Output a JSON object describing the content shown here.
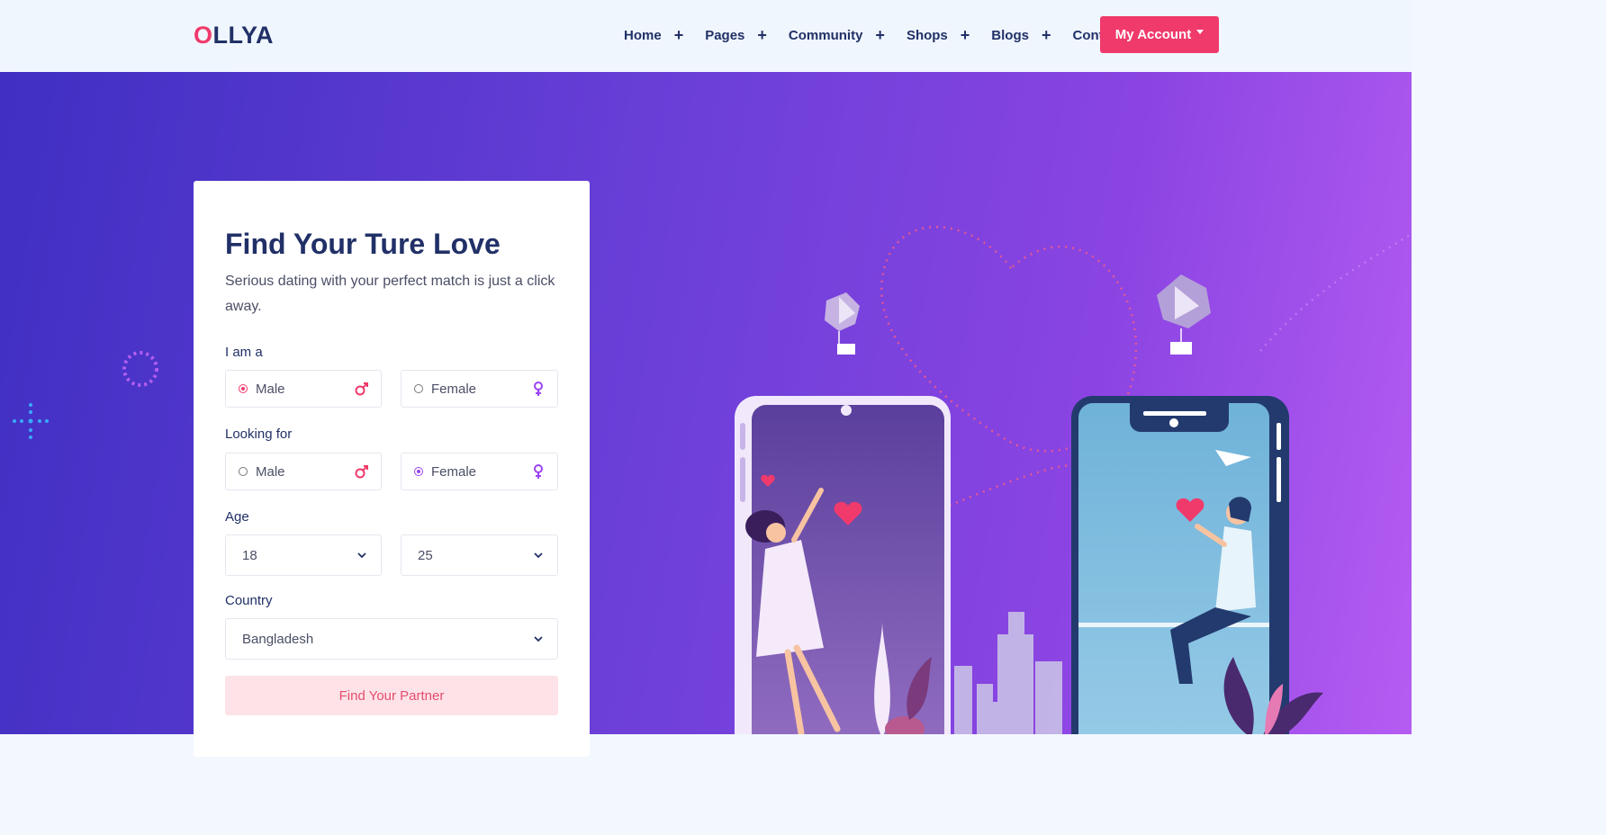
{
  "brand": {
    "logo_first": "O",
    "logo_rest": "LLYA",
    "accent": "#f03a6b",
    "navy": "#213067"
  },
  "nav": {
    "items": [
      {
        "label": "Home",
        "has_plus": true
      },
      {
        "label": "Pages",
        "has_plus": true
      },
      {
        "label": "Community",
        "has_plus": true
      },
      {
        "label": "Shops",
        "has_plus": true
      },
      {
        "label": "Blogs",
        "has_plus": true
      },
      {
        "label": "Contact",
        "has_plus": false
      }
    ],
    "plus": "+",
    "account_label": "My Account"
  },
  "form": {
    "title": "Find Your Ture Love",
    "subtitle": "Serious dating with your perfect match is just a click away.",
    "i_am_label": "I am a",
    "i_am_options": [
      {
        "label": "Male",
        "selected": true,
        "icon": "male-icon"
      },
      {
        "label": "Female",
        "selected": false,
        "icon": "female-icon"
      }
    ],
    "looking_for_label": "Looking for",
    "looking_for_options": [
      {
        "label": "Male",
        "selected": false,
        "icon": "male-icon"
      },
      {
        "label": "Female",
        "selected": true,
        "icon": "female-icon"
      }
    ],
    "age_label": "Age",
    "age_from": "18",
    "age_to": "25",
    "country_label": "Country",
    "country_value": "Bangladesh",
    "submit_label": "Find Your Partner"
  }
}
